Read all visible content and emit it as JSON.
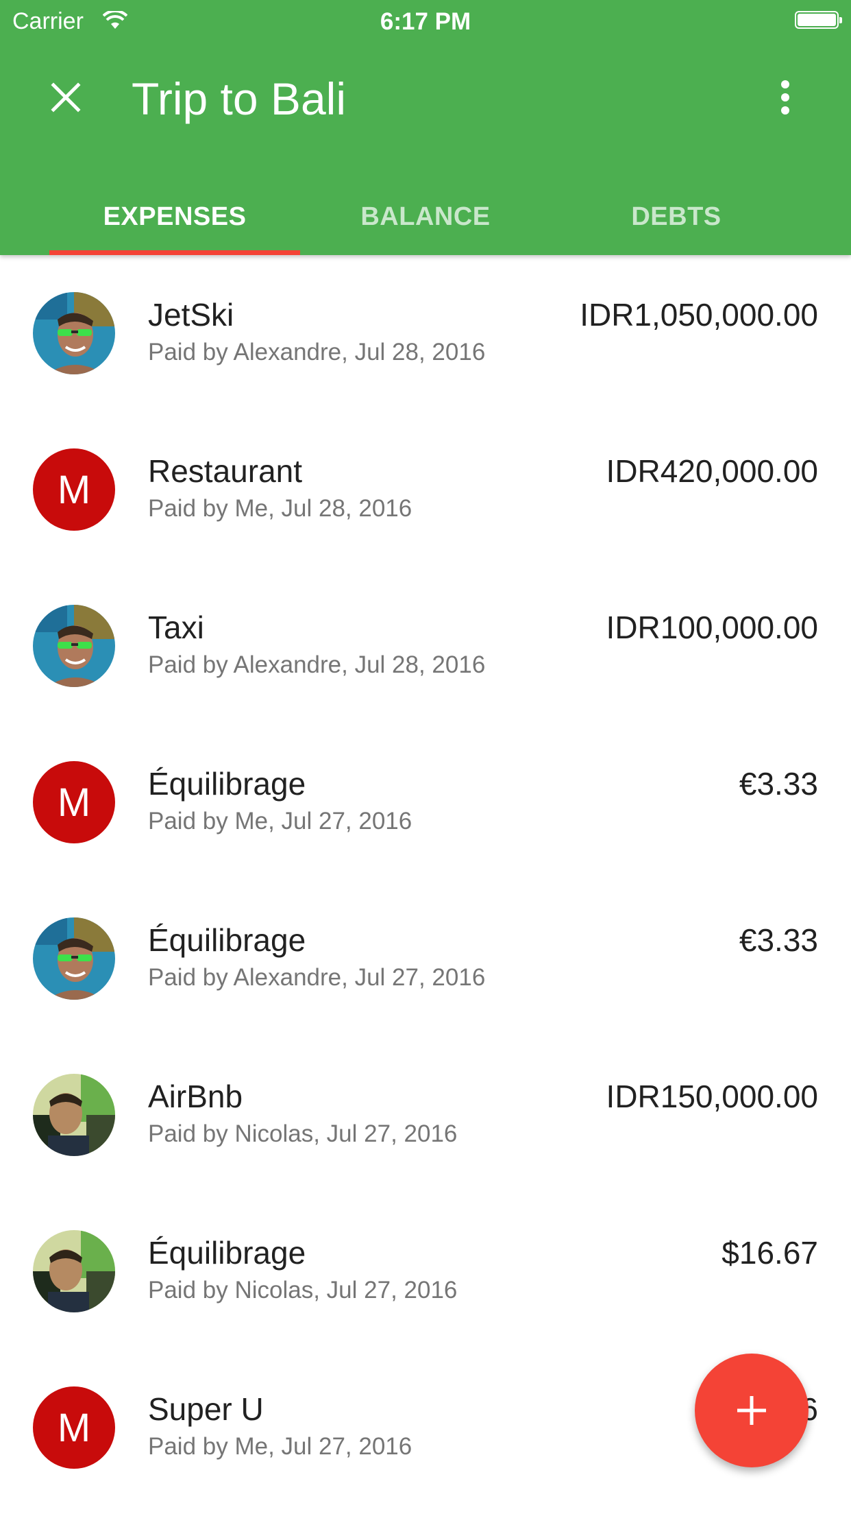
{
  "status_bar": {
    "carrier": "Carrier",
    "time": "6:17 PM"
  },
  "toolbar": {
    "title": "Trip to Bali",
    "close_icon": "close-icon",
    "more_icon": "more-vert-icon"
  },
  "tabs": [
    {
      "label": "EXPENSES",
      "active": true
    },
    {
      "label": "BALANCE",
      "active": false
    },
    {
      "label": "DEBTS",
      "active": false
    }
  ],
  "colors": {
    "primary": "#4caf50",
    "accent": "#f44336",
    "avatar_letter_bg": "#c80b0b"
  },
  "expenses": [
    {
      "name": "JetSki",
      "paid_by": "Paid by Alexandre, Jul 28, 2016",
      "amount": "IDR1,050,000.00",
      "avatar": "photo-alexandre"
    },
    {
      "name": "Restaurant",
      "paid_by": "Paid by Me, Jul 28, 2016",
      "amount": "IDR420,000.00",
      "avatar": "M"
    },
    {
      "name": "Taxi",
      "paid_by": "Paid by Alexandre, Jul 28, 2016",
      "amount": "IDR100,000.00",
      "avatar": "photo-alexandre"
    },
    {
      "name": "Équilibrage",
      "paid_by": "Paid by Me, Jul 27, 2016",
      "amount": "€3.33",
      "avatar": "M"
    },
    {
      "name": "Équilibrage",
      "paid_by": "Paid by Alexandre, Jul 27, 2016",
      "amount": "€3.33",
      "avatar": "photo-alexandre"
    },
    {
      "name": "AirBnb",
      "paid_by": "Paid by Nicolas, Jul 27, 2016",
      "amount": "IDR150,000.00",
      "avatar": "photo-nicolas"
    },
    {
      "name": "Équilibrage",
      "paid_by": "Paid by Nicolas, Jul 27, 2016",
      "amount": "$16.67",
      "avatar": "photo-nicolas"
    },
    {
      "name": "Super U",
      "paid_by": "Paid by Me, Jul 27, 2016",
      "amount": "IDR6",
      "avatar": "M"
    }
  ],
  "fab": {
    "icon": "add-icon"
  }
}
